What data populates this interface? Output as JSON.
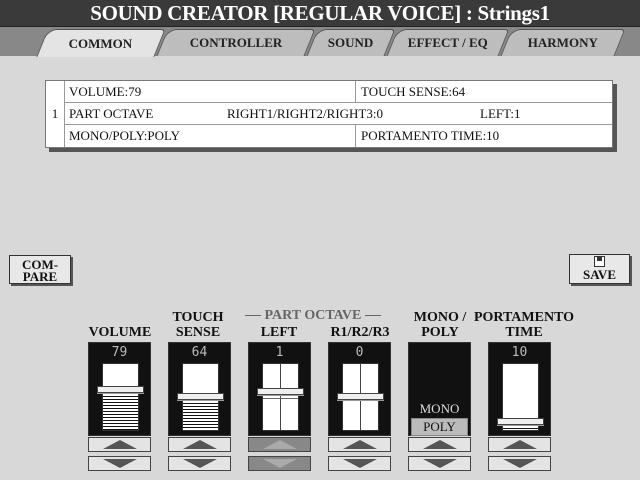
{
  "title": "SOUND CREATOR [REGULAR VOICE] : Strings1",
  "tabs": [
    {
      "label": "COMMON",
      "active": true
    },
    {
      "label": "CONTROLLER",
      "active": false
    },
    {
      "label": "SOUND",
      "active": false
    },
    {
      "label": "EFFECT / EQ",
      "active": false
    },
    {
      "label": "HARMONY",
      "active": false
    }
  ],
  "info": {
    "index": "1",
    "volume": "VOLUME:79",
    "touch_sense": "TOUCH SENSE:64",
    "part_octave": "PART OCTAVE",
    "right_octave": "RIGHT1/RIGHT2/RIGHT3:0",
    "left_octave": "LEFT:1",
    "mono_poly": "MONO/POLY:POLY",
    "portamento": "PORTAMENTO TIME:10"
  },
  "buttons": {
    "compare_line1": "COM-",
    "compare_line2": "PARE",
    "save": "SAVE"
  },
  "group_label": "PART OCTAVE",
  "controls": {
    "volume": {
      "label1": "",
      "label2": "VOLUME",
      "value": "79",
      "level": 0.62
    },
    "touch_sense": {
      "label1": "TOUCH",
      "label2": "SENSE",
      "value": "64",
      "level": 0.5
    },
    "left": {
      "label1": "",
      "label2": "LEFT",
      "value": "1",
      "level": 0.58
    },
    "r123": {
      "label1": "",
      "label2": "R1/R2/R3",
      "value": "0",
      "level": 0.5
    },
    "mono_poly": {
      "label1": "MONO /",
      "label2": "POLY",
      "options": [
        "MONO",
        "POLY"
      ],
      "selected": "POLY"
    },
    "portamento": {
      "label1": "PORTAMENTO",
      "label2": "TIME",
      "value": "10",
      "level": 0.08
    }
  }
}
